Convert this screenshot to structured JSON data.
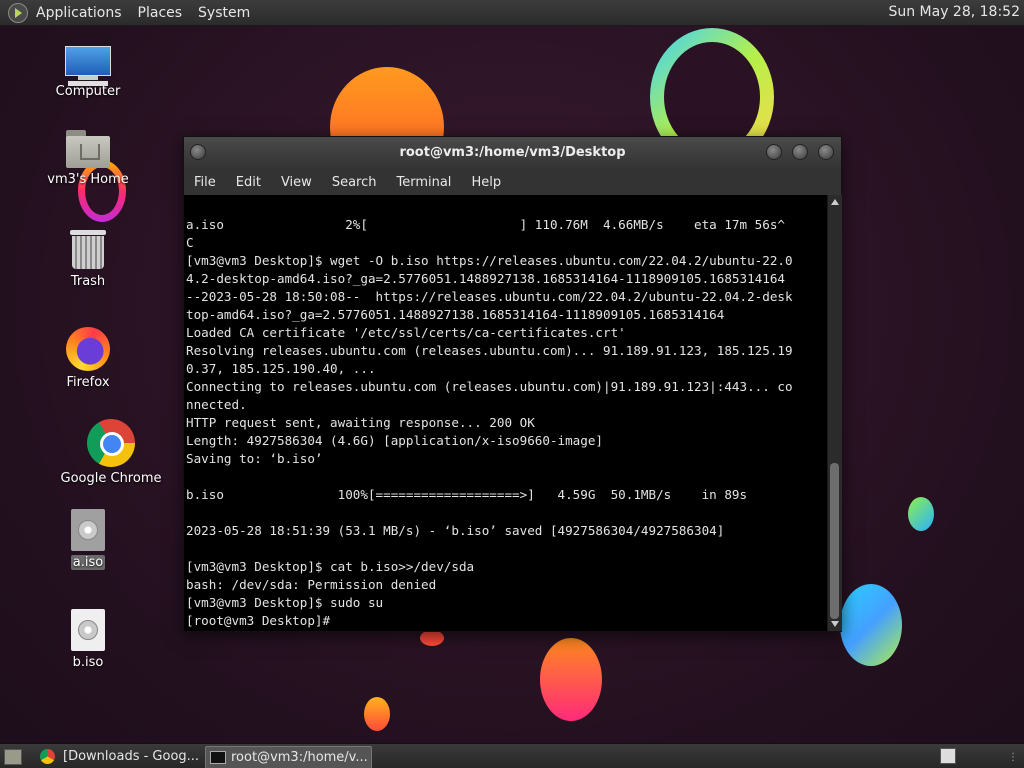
{
  "top_panel": {
    "menus": [
      "Applications",
      "Places",
      "System"
    ],
    "clock": "Sun May 28, 18:52"
  },
  "desktop_icons": {
    "computer": "Computer",
    "home": "vm3's Home",
    "trash": "Trash",
    "firefox": "Firefox",
    "chrome": "Google Chrome",
    "a_iso": "a.iso",
    "b_iso": "b.iso"
  },
  "terminal": {
    "title": "root@vm3:/home/vm3/Desktop",
    "menu": [
      "File",
      "Edit",
      "View",
      "Search",
      "Terminal",
      "Help"
    ],
    "lines": [
      "a.iso                2%[                    ] 110.76M  4.66MB/s    eta 17m 56s^",
      "C",
      "[vm3@vm3 Desktop]$ wget -O b.iso https://releases.ubuntu.com/22.04.2/ubuntu-22.0",
      "4.2-desktop-amd64.iso?_ga=2.5776051.1488927138.1685314164-1118909105.1685314164",
      "--2023-05-28 18:50:08--  https://releases.ubuntu.com/22.04.2/ubuntu-22.04.2-desk",
      "top-amd64.iso?_ga=2.5776051.1488927138.1685314164-1118909105.1685314164",
      "Loaded CA certificate '/etc/ssl/certs/ca-certificates.crt'",
      "Resolving releases.ubuntu.com (releases.ubuntu.com)... 91.189.91.123, 185.125.19",
      "0.37, 185.125.190.40, ...",
      "Connecting to releases.ubuntu.com (releases.ubuntu.com)|91.189.91.123|:443... co",
      "nnected.",
      "HTTP request sent, awaiting response... 200 OK",
      "Length: 4927586304 (4.6G) [application/x-iso9660-image]",
      "Saving to: ‘b.iso’",
      "",
      "b.iso               100%[===================>]   4.59G  50.1MB/s    in 89s",
      "",
      "2023-05-28 18:51:39 (53.1 MB/s) - ‘b.iso’ saved [4927586304/4927586304]",
      "",
      "[vm3@vm3 Desktop]$ cat b.iso>>/dev/sda",
      "bash: /dev/sda: Permission denied",
      "[vm3@vm3 Desktop]$ sudo su",
      "[root@vm3 Desktop]#"
    ]
  },
  "taskbar": {
    "tasks": [
      "[Downloads - Goog...",
      "root@vm3:/home/v..."
    ]
  },
  "colors": {
    "desktop_bg": "#2a1123",
    "panel_bg": "#2b2b2b",
    "terminal_bg": "#000000",
    "terminal_fg": "#e3e3e3"
  }
}
